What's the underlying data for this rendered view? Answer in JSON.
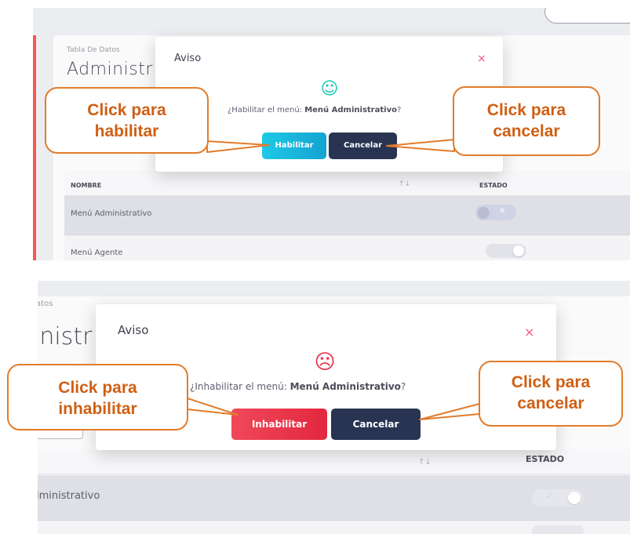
{
  "panel1": {
    "breadcrumb": "Tabla De Datos",
    "title": "Administr",
    "table": {
      "headers": {
        "name": "NOMBRE",
        "sort": "↑↓",
        "estado": "ESTADO"
      },
      "rows": [
        {
          "name": "Menú Administrativo",
          "toggle_state": "off"
        },
        {
          "name": "Menú Agente",
          "toggle_state": "on"
        }
      ]
    },
    "modal": {
      "title": "Aviso",
      "close": "×",
      "face": "☺",
      "text_prefix": "¿Habilitar el menú: ",
      "text_bold": "Menú Administrativo",
      "text_suffix": "?",
      "confirm_label": "Habilitar",
      "cancel_label": "Cancelar"
    },
    "callout_left": [
      "Click para",
      "habilitar"
    ],
    "callout_right": [
      "Click para",
      "cancelar"
    ]
  },
  "panel2": {
    "breadcrumb": "atos",
    "title": "inistr",
    "table": {
      "headers": {
        "sort": "↑↓",
        "estado": "ESTADO"
      },
      "rows": [
        {
          "name": "lministrativo",
          "toggle_state": "on"
        }
      ]
    },
    "modal": {
      "title": "Aviso",
      "close": "×",
      "face": "☹",
      "text_prefix": "¿Inhabilitar el menú: ",
      "text_bold": "Menú Administrativo",
      "text_suffix": "?",
      "confirm_label": "Inhabilitar",
      "cancel_label": "Cancelar"
    },
    "callout_left": [
      "Click para",
      "inhabilitar"
    ],
    "callout_right": [
      "Click para",
      "cancelar"
    ]
  },
  "colors": {
    "accent_orange": "#e17c2c",
    "callout_text": "#cf5f13",
    "habilitar_button": "#16b3d8",
    "inhabilitar_button": "#e8324a",
    "cancel_button": "#283452",
    "face_happy": "#16c7b0",
    "face_sad": "#e8324a",
    "close_x": "#f05a7e"
  },
  "icons": [
    "smile-icon",
    "frown-icon",
    "close-icon",
    "sort-icon",
    "toggle-switch"
  ]
}
